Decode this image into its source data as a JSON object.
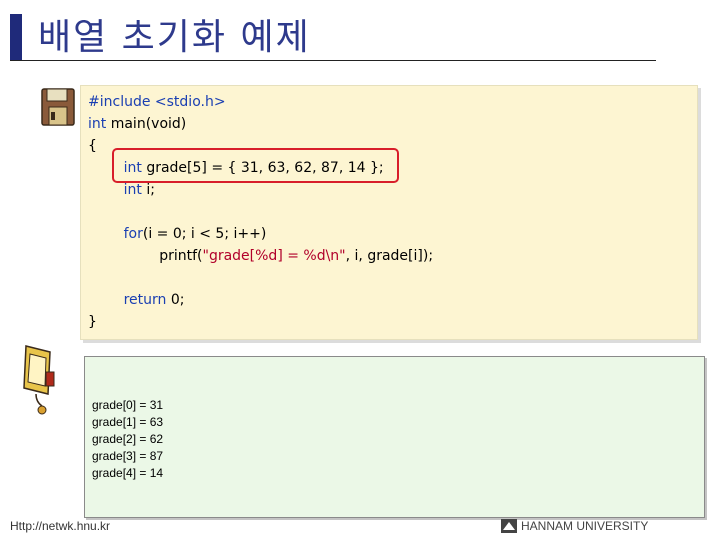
{
  "title": "배열 초기화 예제",
  "code": {
    "lines": [
      [
        {
          "t": "#include <stdio.h>",
          "c": "kw"
        }
      ],
      [
        {
          "t": "int",
          "c": "kw"
        },
        {
          "t": " main(void)",
          "c": ""
        }
      ],
      [
        {
          "t": "{",
          "c": ""
        }
      ],
      [
        {
          "t": "        ",
          "c": ""
        },
        {
          "t": "int",
          "c": "kw"
        },
        {
          "t": " grade[5] = { 31, 63, 62, 87, 14 };",
          "c": ""
        }
      ],
      [
        {
          "t": "        ",
          "c": ""
        },
        {
          "t": "int",
          "c": "kw"
        },
        {
          "t": " i;",
          "c": ""
        }
      ],
      [
        {
          "t": "",
          "c": ""
        }
      ],
      [
        {
          "t": "        ",
          "c": ""
        },
        {
          "t": "for",
          "c": "kw"
        },
        {
          "t": "(i = 0; i < 5; i++)",
          "c": ""
        }
      ],
      [
        {
          "t": "                printf(",
          "c": ""
        },
        {
          "t": "\"grade[%d] = %d\\n\"",
          "c": "str"
        },
        {
          "t": ", i, grade[i]);",
          "c": ""
        }
      ],
      [
        {
          "t": "",
          "c": ""
        }
      ],
      [
        {
          "t": "        ",
          "c": ""
        },
        {
          "t": "return",
          "c": "kw"
        },
        {
          "t": " 0;",
          "c": ""
        }
      ],
      [
        {
          "t": "}",
          "c": ""
        }
      ]
    ]
  },
  "output": {
    "lines": [
      "grade[0] = 31",
      "grade[1] = 63",
      "grade[2] = 62",
      "grade[3] = 87",
      "grade[4] = 14"
    ]
  },
  "footer": {
    "url": "Http://netwk.hnu.kr",
    "university": "HANNAM UNIVERSITY"
  },
  "colors": {
    "title_bar": "#1f2a7a",
    "code_bg": "#fdf5d2",
    "keyword": "#1a3fb2",
    "string": "#b1002a",
    "highlight_border": "#d81e2a",
    "output_bg": "#ebf8e7"
  },
  "icons": [
    "floppy-disk-icon",
    "monitor-icon",
    "university-logo-icon"
  ]
}
